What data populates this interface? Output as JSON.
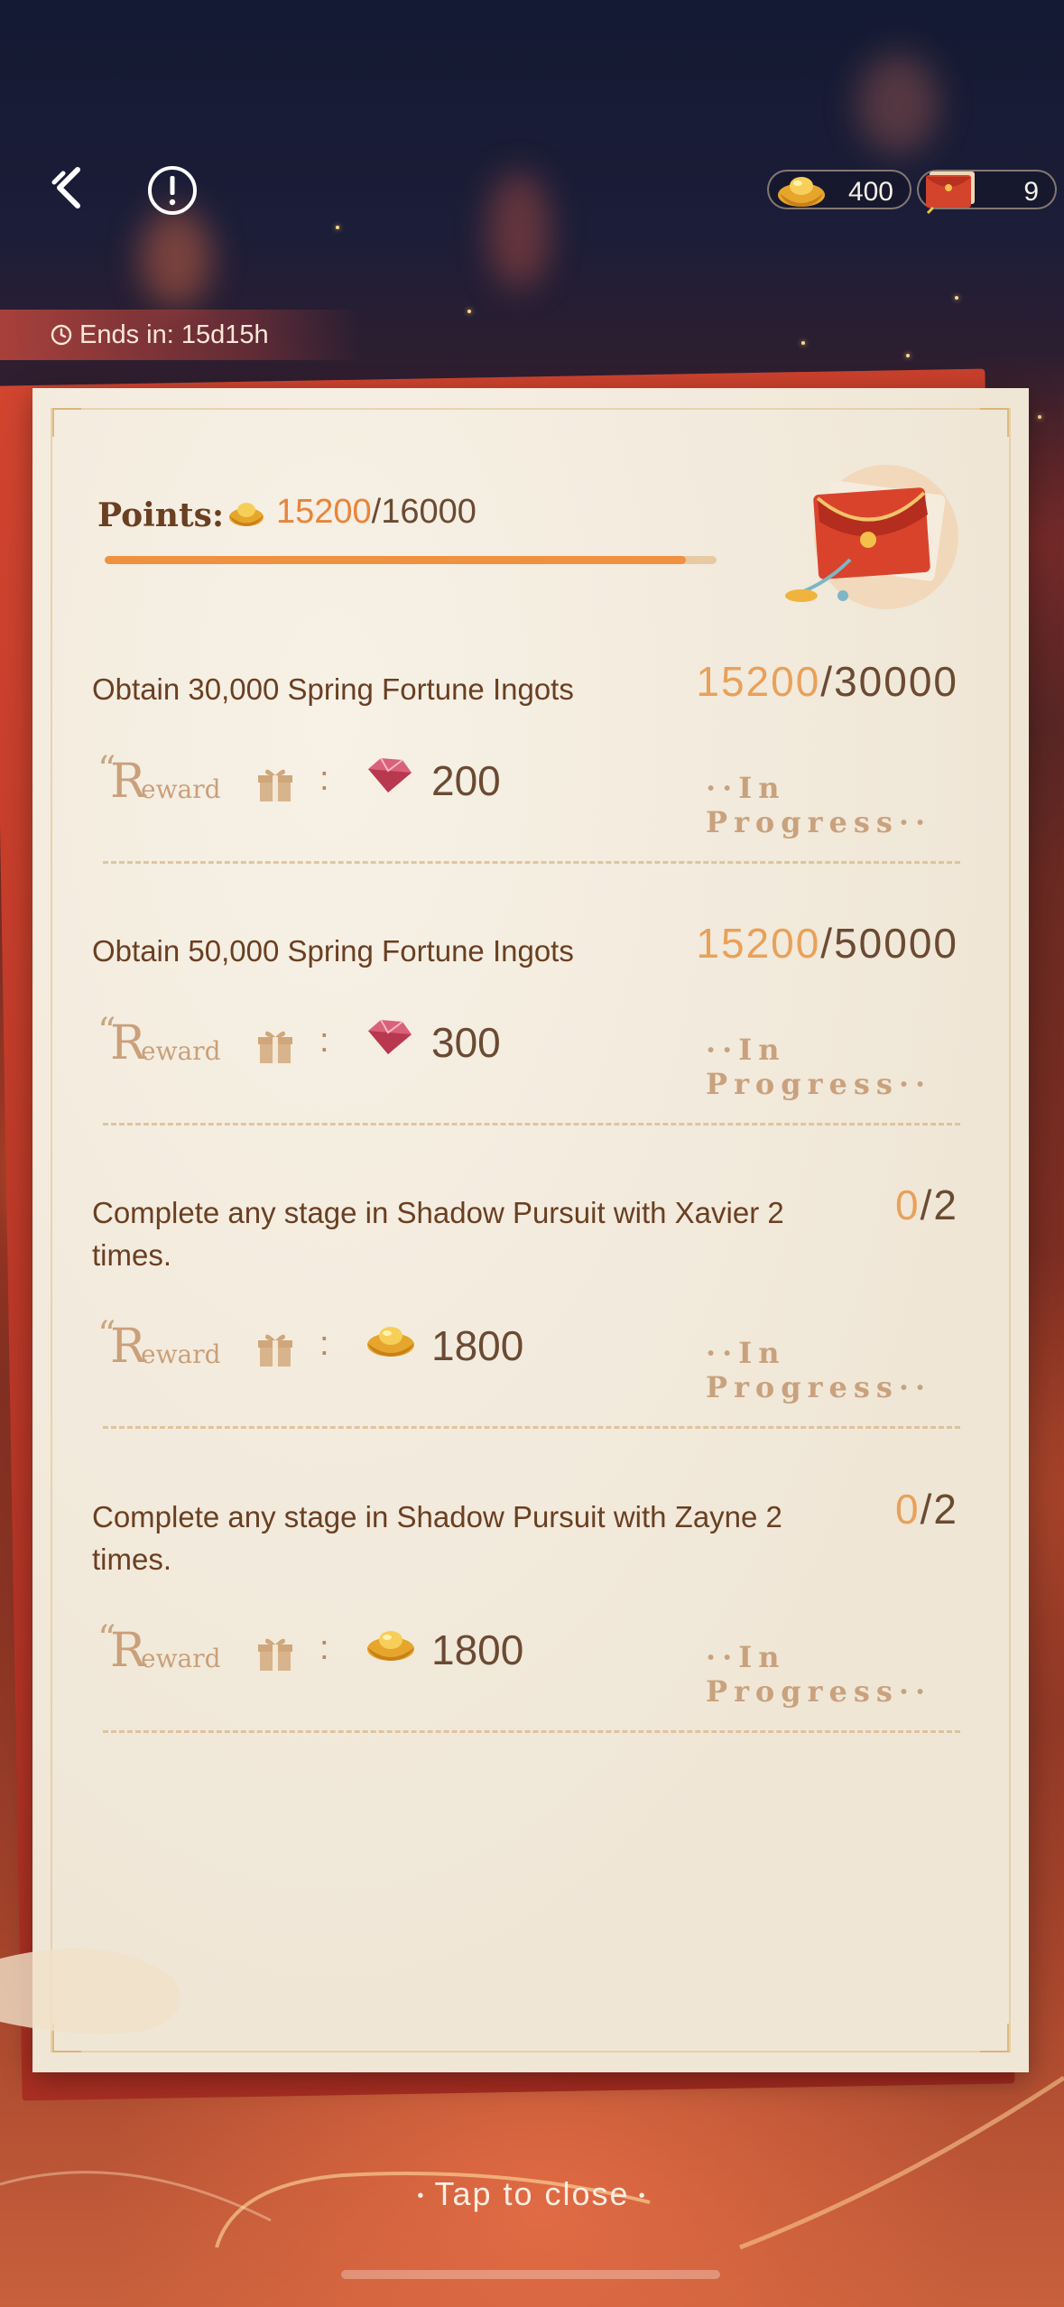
{
  "topbar": {
    "currencies": [
      {
        "icon": "gold-ingot-icon",
        "value": "400"
      },
      {
        "icon": "red-envelope-icon",
        "value": "9"
      }
    ]
  },
  "event": {
    "ends_in": "Ends in: 15d15h"
  },
  "points": {
    "label": "Points:",
    "current": "15200",
    "total": "/16000",
    "progress_fraction": 0.95
  },
  "tasks": [
    {
      "title": "Obtain 30,000 Spring Fortune Ingots",
      "current": "15200",
      "total": "/30000",
      "reward_icon": "gem-icon",
      "reward_amount": "200",
      "status": "··In Progress··"
    },
    {
      "title": "Obtain 50,000 Spring Fortune Ingots",
      "current": "15200",
      "total": "/50000",
      "reward_icon": "gem-icon",
      "reward_amount": "300",
      "status": "··In Progress··"
    },
    {
      "title": "Complete any stage in Shadow Pursuit with Xavier 2 times.",
      "current": "0",
      "total": "/2",
      "reward_icon": "gold-ingot-icon",
      "reward_amount": "1800",
      "status": "··In Progress··"
    },
    {
      "title": "Complete any stage in Shadow Pursuit with Zayne 2 times.",
      "current": "0",
      "total": "/2",
      "reward_icon": "gold-ingot-icon",
      "reward_amount": "1800",
      "status": "··In Progress··"
    }
  ],
  "reward_label": {
    "quote": "“",
    "R": "R",
    "rest": "eward"
  },
  "colon": ":",
  "footer": {
    "close_label": "Tap to close",
    "dot": "•"
  },
  "colors": {
    "accent": "#e8843a",
    "text": "#6a3f22",
    "panel": "#f2ebdf"
  }
}
